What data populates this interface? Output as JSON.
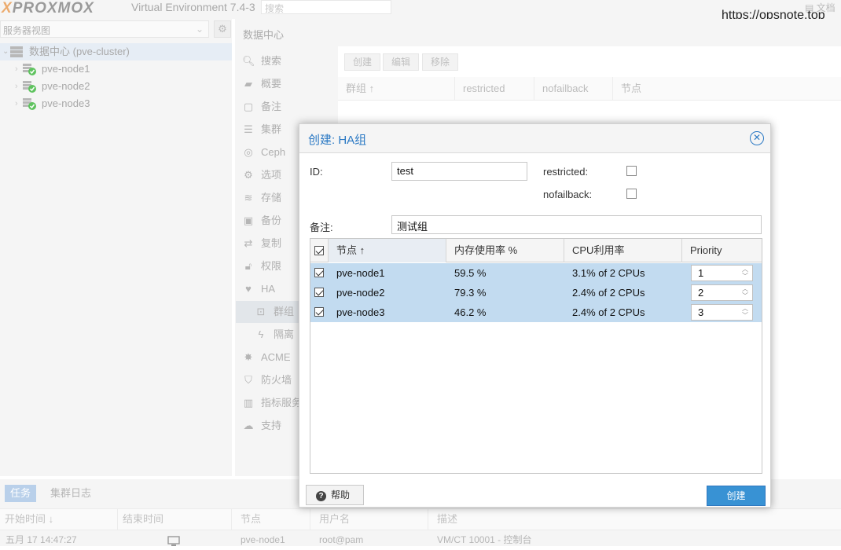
{
  "topbar": {
    "logo": "PROXMOX",
    "product_title": "Virtual Environment 7.4-3",
    "search_placeholder": "搜索",
    "docs_label": "文档",
    "watermark": "https://opsnote.top"
  },
  "tree": {
    "view_select_value": "服务器视图",
    "items": [
      {
        "label": "数据中心 (pve-cluster)"
      },
      {
        "label": "pve-node1"
      },
      {
        "label": "pve-node2"
      },
      {
        "label": "pve-node3"
      }
    ]
  },
  "breadcrumb": "数据中心",
  "nav": {
    "items": [
      {
        "label": "搜索",
        "icon": "search-icon"
      },
      {
        "label": "概要",
        "icon": "book-icon"
      },
      {
        "label": "备注",
        "icon": "note-icon"
      },
      {
        "label": "集群",
        "icon": "server-icon"
      },
      {
        "label": "Ceph",
        "icon": "ceph-icon"
      },
      {
        "label": "选项",
        "icon": "gear-icon"
      },
      {
        "label": "存储",
        "icon": "database-icon"
      },
      {
        "label": "备份",
        "icon": "floppy-icon"
      },
      {
        "label": "复制",
        "icon": "retweet-icon"
      },
      {
        "label": "权限",
        "icon": "unlock-icon"
      },
      {
        "label": "HA",
        "icon": "heartbeat-icon"
      },
      {
        "label": "群组",
        "icon": "object-group-icon"
      },
      {
        "label": "隔离",
        "icon": "bolt-icon"
      },
      {
        "label": "ACME",
        "icon": "certificate-icon"
      },
      {
        "label": "防火墙",
        "icon": "shield-icon"
      },
      {
        "label": "指标服务",
        "icon": "bar-chart-icon"
      },
      {
        "label": "支持",
        "icon": "comments-icon"
      }
    ]
  },
  "groups_toolbar": {
    "create": "创建",
    "edit": "编辑",
    "remove": "移除"
  },
  "groups_grid": {
    "columns": [
      "群组 ↑",
      "restricted",
      "nofailback",
      "节点"
    ]
  },
  "dialog": {
    "title": "创建: HA组",
    "id_label": "ID:",
    "id_value": "test",
    "restricted_label": "restricted:",
    "nofailback_label": "nofailback:",
    "comment_label": "备注:",
    "comment_value": "测试组",
    "grid": {
      "columns": [
        "节点 ↑",
        "内存使用率 %",
        "CPU利用率",
        "Priority"
      ],
      "rows": [
        {
          "node": "pve-node1",
          "mem": "59.5 %",
          "cpu": "3.1% of 2 CPUs",
          "priority": "1",
          "checked": true
        },
        {
          "node": "pve-node2",
          "mem": "79.3 %",
          "cpu": "2.4% of 2 CPUs",
          "priority": "2",
          "checked": true
        },
        {
          "node": "pve-node3",
          "mem": "46.2 %",
          "cpu": "2.4% of 2 CPUs",
          "priority": "3",
          "checked": true
        }
      ]
    },
    "help_label": "帮助",
    "create_label": "创建"
  },
  "bottom": {
    "tabs": [
      "任务",
      "集群日志"
    ],
    "columns": [
      "开始时间 ↓",
      "结束时间",
      "节点",
      "用户名",
      "描述"
    ],
    "row": {
      "start": "五月 17 14:47:27",
      "node": "pve-node1",
      "user": "root@pam",
      "desc": "VM/CT 10001 - 控制台"
    }
  },
  "colors": {
    "accent": "#3892d4",
    "selection": "#c2dbf0",
    "title": "#2b79c4"
  }
}
